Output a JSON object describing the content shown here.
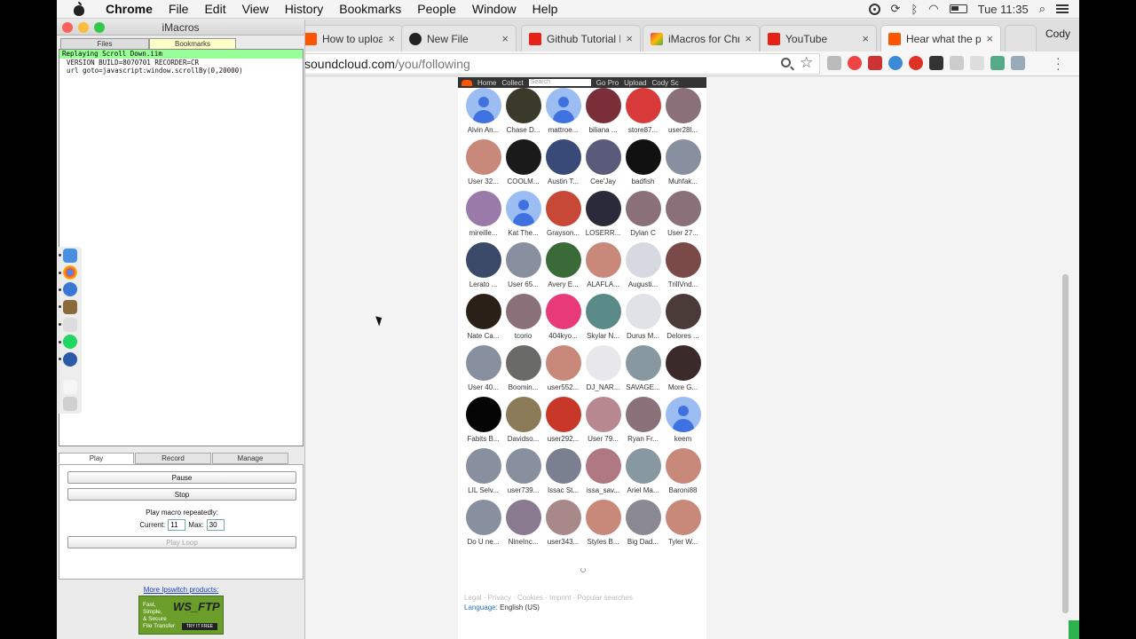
{
  "menubar": {
    "app": "Chrome",
    "items": [
      "File",
      "Edit",
      "View",
      "History",
      "Bookmarks",
      "People",
      "Window",
      "Help"
    ],
    "clock": "Tue 11:35"
  },
  "browser": {
    "tabs": [
      {
        "title": "How to upload to",
        "icon": "soundcloud-icon",
        "active": false
      },
      {
        "title": "New File",
        "icon": "github-icon",
        "active": false
      },
      {
        "title": "Github Tutorial F",
        "icon": "youtube-icon",
        "active": false
      },
      {
        "title": "iMacros for Chro",
        "icon": "imacros-icon",
        "active": false
      },
      {
        "title": "YouTube",
        "icon": "youtube-icon",
        "active": false
      },
      {
        "title": "Hear what the pe",
        "icon": "soundcloud-icon",
        "active": true
      }
    ],
    "profile": "Cody",
    "url_host": "soundcloud.com",
    "url_path": "/you/following"
  },
  "soundcloud": {
    "header": {
      "home": "Home",
      "collection": "Collect",
      "search_placeholder": "Search",
      "go_pro": "Go Pro",
      "upload": "Upload",
      "user": "Cody Sc"
    },
    "users": [
      {
        "name": "Alvin An...",
        "avatar": "default"
      },
      {
        "name": "Chase D...",
        "color": "#3a3a2a"
      },
      {
        "name": "mattroe...",
        "avatar": "default"
      },
      {
        "name": "biliana ...",
        "color": "#7a2e38"
      },
      {
        "name": "store87...",
        "color": "#d83a3a"
      },
      {
        "name": "user28l...",
        "color": "#8a7078"
      },
      {
        "name": "User 32...",
        "color": "#c8887a"
      },
      {
        "name": "COOLM...",
        "color": "#1a1a1a"
      },
      {
        "name": "Austin T...",
        "color": "#3a4a78"
      },
      {
        "name": "Cee'Jay",
        "color": "#5a5a7a"
      },
      {
        "name": "badfish",
        "color": "#111111"
      },
      {
        "name": "Muhfak...",
        "color": "#8890a0"
      },
      {
        "name": "mireille...",
        "color": "#9a7aa8"
      },
      {
        "name": "Kat The...",
        "avatar": "default"
      },
      {
        "name": "Grayson...",
        "color": "#c84838"
      },
      {
        "name": "LOSERR...",
        "color": "#2a2a38"
      },
      {
        "name": "Dylan C",
        "color": "#8a7078"
      },
      {
        "name": "User 27...",
        "color": "#8a7078"
      },
      {
        "name": "Lerato ...",
        "color": "#3a4a68"
      },
      {
        "name": "User 65...",
        "color": "#8890a0"
      },
      {
        "name": "Avery E...",
        "color": "#3a6a38"
      },
      {
        "name": "ALAFLA...",
        "color": "#c8887a"
      },
      {
        "name": "Augusti...",
        "color": "#d8d8e0"
      },
      {
        "name": "TrillVnd...",
        "color": "#7a4a48"
      },
      {
        "name": "Nate Ca...",
        "color": "#2a2018"
      },
      {
        "name": "tcorio",
        "color": "#8a7078"
      },
      {
        "name": "404kyo...",
        "color": "#e83a78"
      },
      {
        "name": "Skylar N...",
        "color": "#5a8a88"
      },
      {
        "name": "Durus M...",
        "color": "#e0e2e8"
      },
      {
        "name": "Delores ...",
        "color": "#4a3a38"
      },
      {
        "name": "User 40...",
        "color": "#8890a0"
      },
      {
        "name": "Boomin...",
        "color": "#6a6a68"
      },
      {
        "name": "user552...",
        "color": "#c8887a"
      },
      {
        "name": "DJ_NAR...",
        "color": "#e8e8ec"
      },
      {
        "name": "SAVAGE...",
        "color": "#8898a0"
      },
      {
        "name": "More G...",
        "color": "#3a2a2a"
      },
      {
        "name": "Fabits B...",
        "color": "#050505"
      },
      {
        "name": "Davidso...",
        "color": "#8a7a58"
      },
      {
        "name": "user292...",
        "color": "#c83828"
      },
      {
        "name": "User 79...",
        "color": "#b88890"
      },
      {
        "name": "Ryan Fr...",
        "color": "#8a7078"
      },
      {
        "name": "keem",
        "avatar": "default"
      },
      {
        "name": "LIL Selv...",
        "color": "#8890a0"
      },
      {
        "name": "user739...",
        "color": "#8890a0"
      },
      {
        "name": "Issac St...",
        "color": "#7a8090"
      },
      {
        "name": "issa_sav...",
        "color": "#b07880"
      },
      {
        "name": "Ariel Ma...",
        "color": "#8898a0"
      },
      {
        "name": "Baroni88",
        "color": "#c8887a"
      },
      {
        "name": "Do U ne...",
        "color": "#8890a0"
      },
      {
        "name": "NineInc...",
        "color": "#8a7a90"
      },
      {
        "name": "user343...",
        "color": "#a88888"
      },
      {
        "name": "Styles B...",
        "color": "#c8887a"
      },
      {
        "name": "Big Dad...",
        "color": "#8a8890"
      },
      {
        "name": "Tyler W...",
        "color": "#c8887a"
      }
    ],
    "footer_links": "Legal · Privacy · Cookies · Imprint · Popular searches",
    "language_label": "Language:",
    "language_value": "English (US)"
  },
  "imacros": {
    "title": "iMacros",
    "tabs": {
      "files": "Files",
      "bookmarks": "Bookmarks"
    },
    "status": "Replaying Scroll Down.iim",
    "code": [
      "VERSION BUILD=8070701 RECORDER=CR",
      "url goto=javascript:window.scrollBy(0,20000)"
    ],
    "control_tabs": {
      "play": "Play",
      "record": "Record",
      "manage": "Manage"
    },
    "pause": "Pause",
    "stop": "Stop",
    "repeat_label": "Play macro repeatedly:",
    "current_label": "Current:",
    "current_value": "11",
    "max_label": "Max:",
    "max_value": "30",
    "play_loop": "Play Loop",
    "more_products": "More Ipswitch products:",
    "ad": {
      "line1": "Fast,",
      "line2": "Simple,",
      "line3": "& Secure",
      "line4": "File Transfer",
      "brand": "WS_FTP",
      "cta": "TRY IT FREE"
    }
  }
}
